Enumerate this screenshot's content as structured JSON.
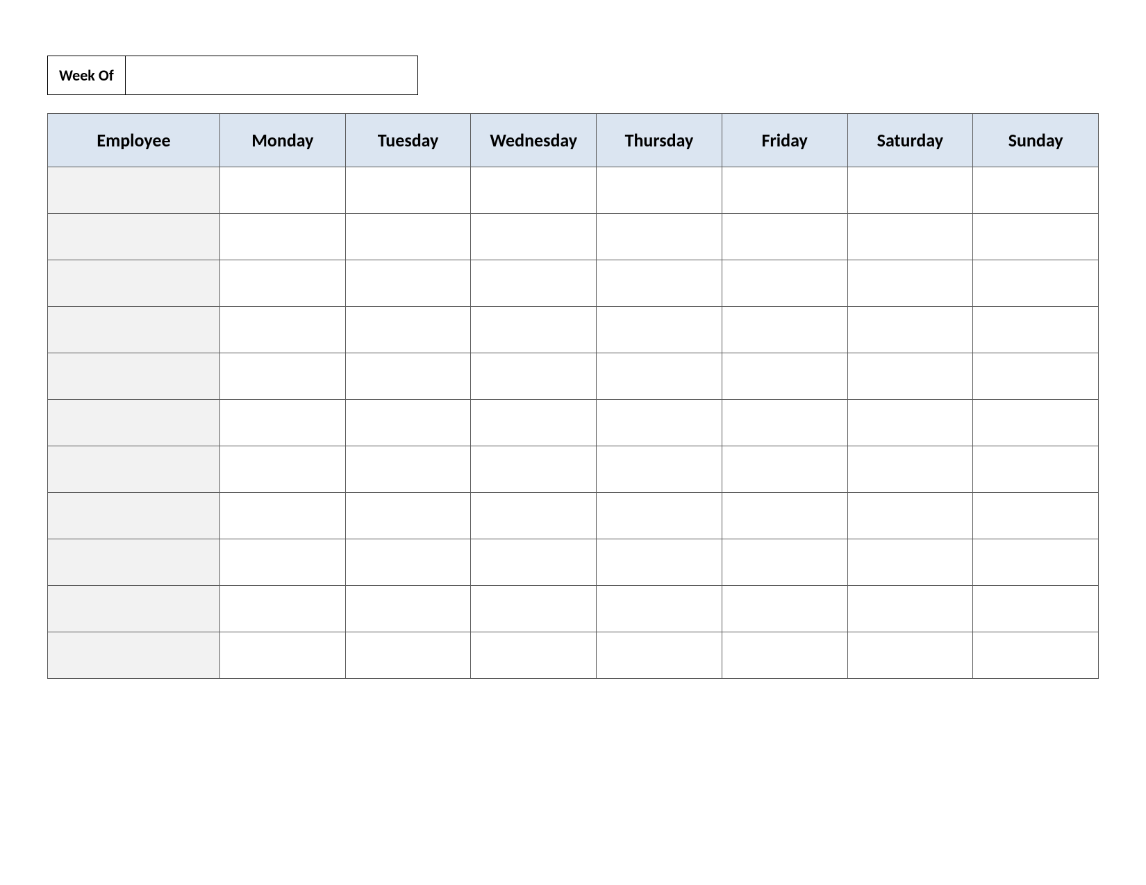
{
  "weekOf": {
    "label": "Week Of",
    "value": ""
  },
  "columns": [
    "Employee",
    "Monday",
    "Tuesday",
    "Wednesday",
    "Thursday",
    "Friday",
    "Saturday",
    "Sunday"
  ],
  "rows": [
    {
      "employee": "",
      "mon": "",
      "tue": "",
      "wed": "",
      "thu": "",
      "fri": "",
      "sat": "",
      "sun": ""
    },
    {
      "employee": "",
      "mon": "",
      "tue": "",
      "wed": "",
      "thu": "",
      "fri": "",
      "sat": "",
      "sun": ""
    },
    {
      "employee": "",
      "mon": "",
      "tue": "",
      "wed": "",
      "thu": "",
      "fri": "",
      "sat": "",
      "sun": ""
    },
    {
      "employee": "",
      "mon": "",
      "tue": "",
      "wed": "",
      "thu": "",
      "fri": "",
      "sat": "",
      "sun": ""
    },
    {
      "employee": "",
      "mon": "",
      "tue": "",
      "wed": "",
      "thu": "",
      "fri": "",
      "sat": "",
      "sun": ""
    },
    {
      "employee": "",
      "mon": "",
      "tue": "",
      "wed": "",
      "thu": "",
      "fri": "",
      "sat": "",
      "sun": ""
    },
    {
      "employee": "",
      "mon": "",
      "tue": "",
      "wed": "",
      "thu": "",
      "fri": "",
      "sat": "",
      "sun": ""
    },
    {
      "employee": "",
      "mon": "",
      "tue": "",
      "wed": "",
      "thu": "",
      "fri": "",
      "sat": "",
      "sun": ""
    },
    {
      "employee": "",
      "mon": "",
      "tue": "",
      "wed": "",
      "thu": "",
      "fri": "",
      "sat": "",
      "sun": ""
    },
    {
      "employee": "",
      "mon": "",
      "tue": "",
      "wed": "",
      "thu": "",
      "fri": "",
      "sat": "",
      "sun": ""
    },
    {
      "employee": "",
      "mon": "",
      "tue": "",
      "wed": "",
      "thu": "",
      "fri": "",
      "sat": "",
      "sun": ""
    }
  ]
}
